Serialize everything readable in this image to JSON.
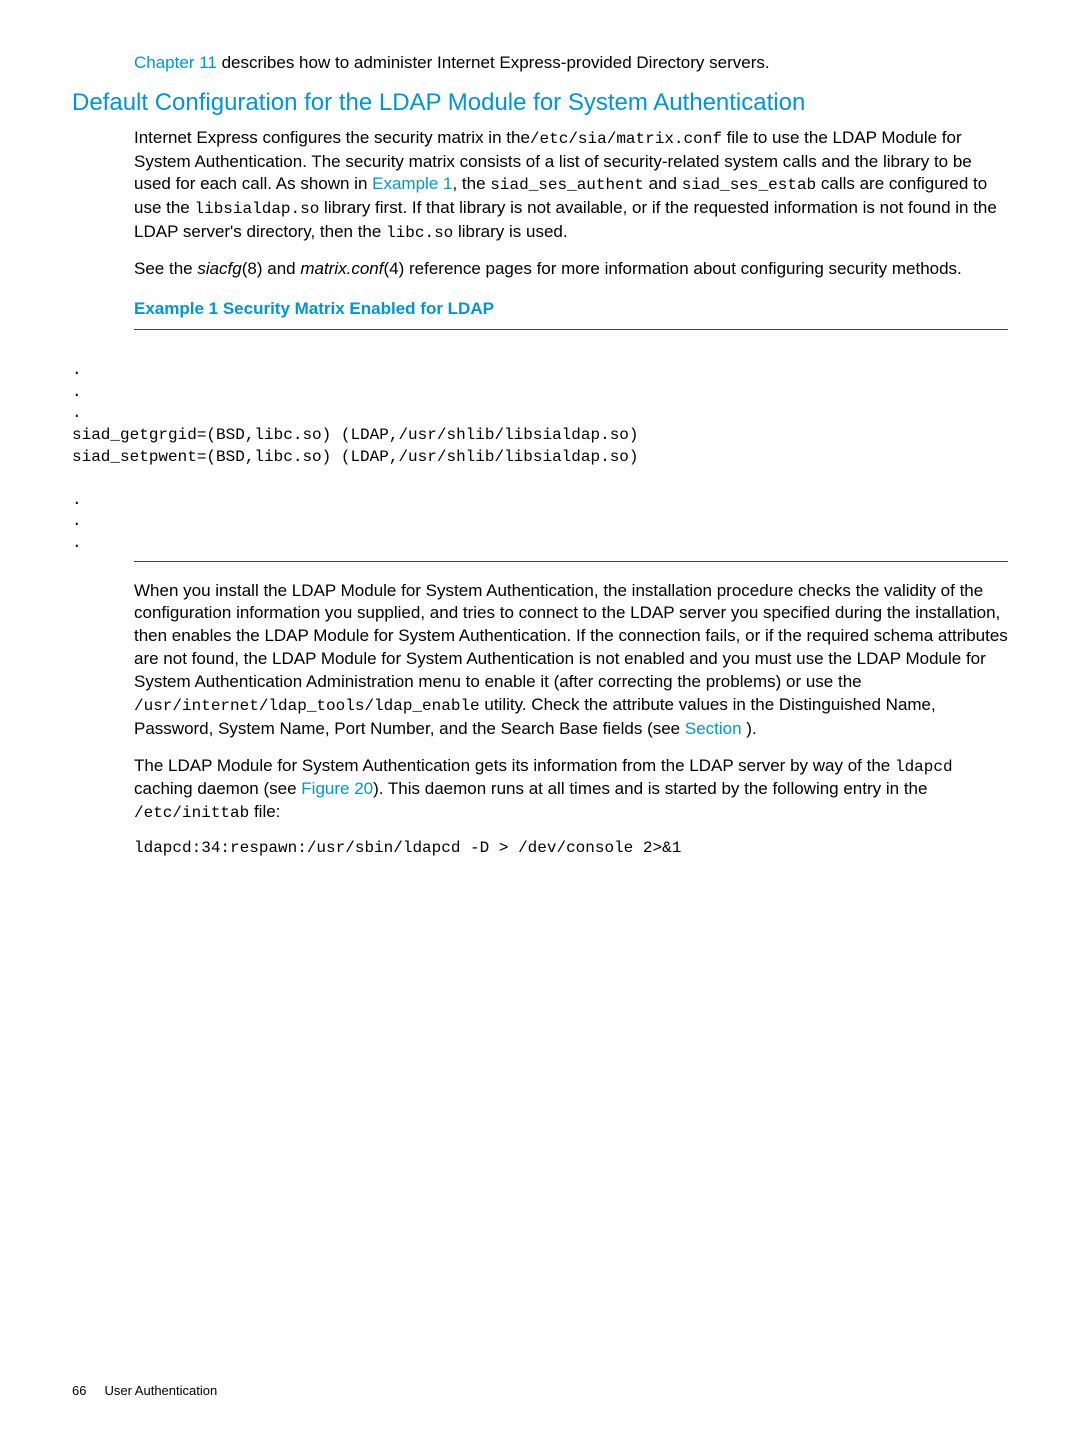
{
  "top_para": {
    "link": "Chapter 11",
    "rest": " describes how to administer Internet Express-provided Directory servers."
  },
  "section_heading": "Default Configuration for the LDAP Module for System Authentication",
  "para1": {
    "t1": "Internet Express configures the security matrix in the",
    "code1": "/etc/sia/matrix.conf",
    "t2": " file to use the LDAP Module for System Authentication. The security matrix consists of a list of security-related system calls and the library to be used for each call. As shown in ",
    "link1": "Example 1",
    "t3": ", the ",
    "code2": "siad_ses_authent",
    "t4": " and ",
    "code3": "siad_ses_estab",
    "t5": " calls are configured to use the ",
    "code4": "libsialdap.so",
    "t6": " library first. If that library is not available, or if the requested information is not found in the LDAP server's directory, then the ",
    "code5": "libc.so",
    "t7": " library is used."
  },
  "para2": {
    "t1": "See the ",
    "it1": "siacfg",
    "t2": "(8) and ",
    "it2": "matrix.conf",
    "t3": "(4) reference pages for more information about configuring security methods."
  },
  "example_heading": "Example 1 Security Matrix Enabled for LDAP",
  "code_block": ".\n.\n.\nsiad_getgrgid=(BSD,libc.so) (LDAP,/usr/shlib/libsialdap.so)\nsiad_setpwent=(BSD,libc.so) (LDAP,/usr/shlib/libsialdap.so)\n\n.\n.\n.",
  "para3": {
    "t1": "When you install the LDAP Module for System Authentication, the installation procedure checks the validity of the configuration information you supplied, and tries to connect to the LDAP server you specified during the installation, then enables the LDAP Module for System Authentication. If the connection fails, or if the required schema attributes are not found, the LDAP Module for System Authentication is not enabled and you must use the LDAP Module for System Authentication Administration menu to enable it (after correcting the problems) or use the ",
    "code1": "/usr/internet/ldap_tools/ldap_enable",
    "t2": " utility. Check the attribute values in the Distinguished Name, Password, System Name, Port Number, and the Search Base fields (see ",
    "link1": "Section ",
    "t3": ")."
  },
  "para4": {
    "t1": "The LDAP Module for System Authentication gets its information from the LDAP server by way of the ",
    "code1": "ldapcd",
    "t2": " caching daemon (see ",
    "link1": "Figure 20",
    "t3": "). This daemon runs at all times and is started by the following entry in the ",
    "code2": "/etc/inittab",
    "t4": " file:"
  },
  "code_line": "ldapcd:34:respawn:/usr/sbin/ldapcd -D > /dev/console 2>&1",
  "footer": {
    "page": "66",
    "title": "User Authentication"
  }
}
